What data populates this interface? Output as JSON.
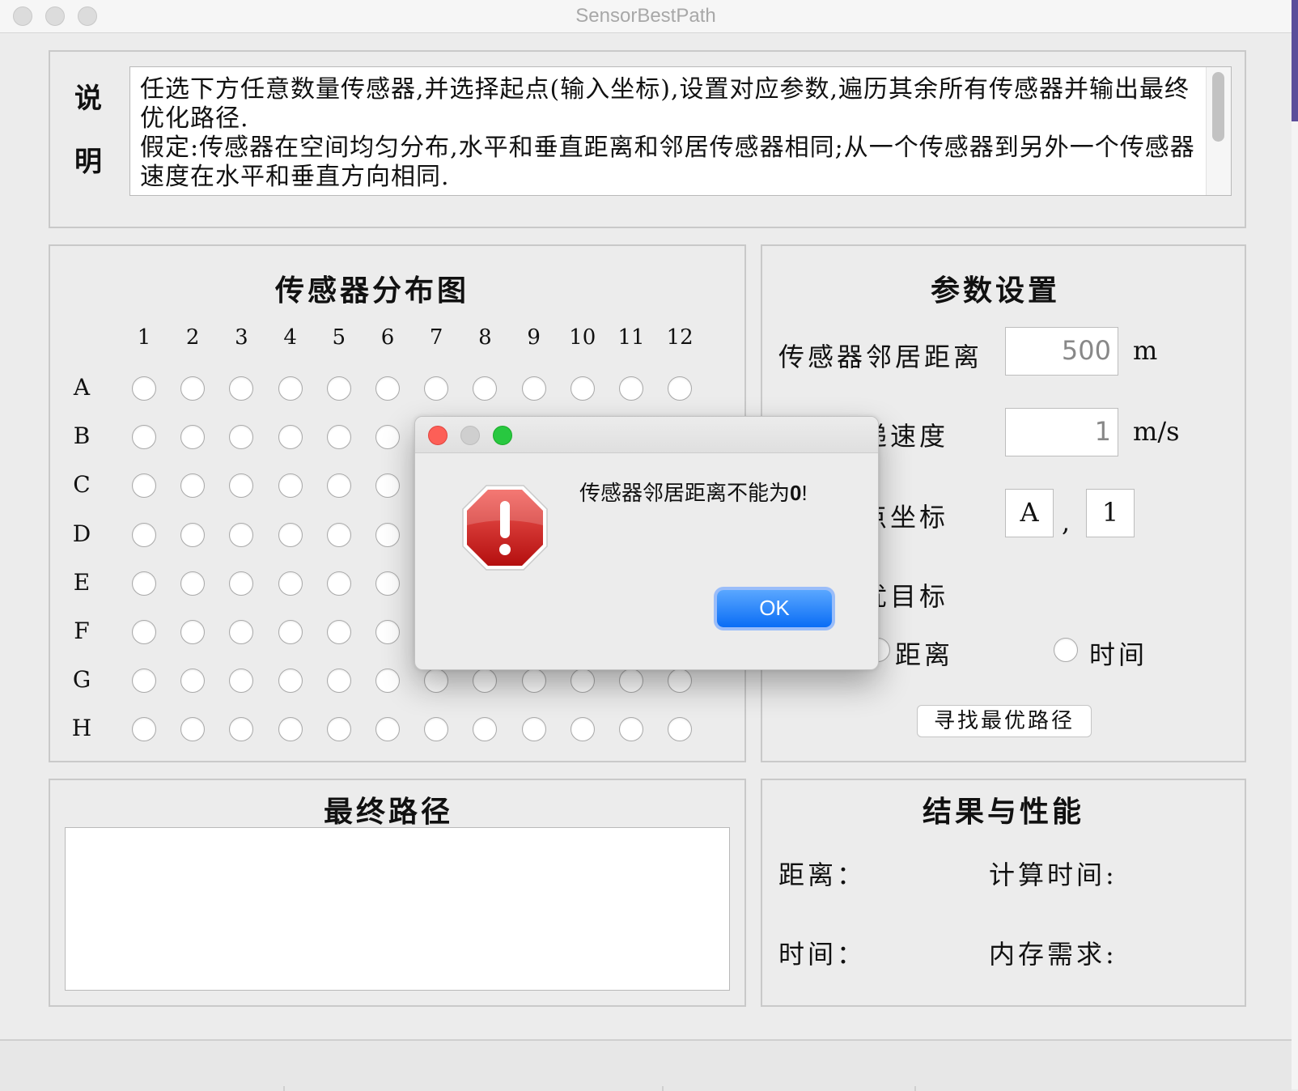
{
  "window": {
    "title": "SensorBestPath"
  },
  "description": {
    "label_line1": "说",
    "label_line2": "明",
    "text_p1": "任选下方任意数量传感器,并选择起点(输入坐标),设置对应参数,遍历其余所有传感器并输出最终优化路径.",
    "text_p2": "假定:传感器在空间均匀分布,水平和垂直距离和邻居传感器相同;从一个传感器到另外一个传感器速度在水平和垂直方向相同."
  },
  "sensor_map": {
    "title": "传感器分布图",
    "columns": [
      "1",
      "2",
      "3",
      "4",
      "5",
      "6",
      "7",
      "8",
      "9",
      "10",
      "11",
      "12"
    ],
    "rows": [
      "A",
      "B",
      "C",
      "D",
      "E",
      "F",
      "G",
      "H"
    ]
  },
  "params": {
    "title": "参数设置",
    "neighbor_distance_label": "传感器邻居距离",
    "neighbor_distance_value": "500",
    "neighbor_distance_unit": "m",
    "speed_label": "传递速度",
    "speed_value": "1",
    "speed_unit": "m/s",
    "start_label": "起点坐标",
    "start_row": "A",
    "start_sep": ",",
    "start_col": "1",
    "target_label": "最优目标",
    "option_distance": "距离",
    "option_time": "时间",
    "find_button": "寻找最优路径"
  },
  "final_path": {
    "title": "最终路径"
  },
  "results": {
    "title": "结果与性能",
    "distance_label": "距离：",
    "calc_time_label": "计算时间:",
    "time_label": "时间：",
    "memory_label": "内存需求:"
  },
  "dialog": {
    "message_prefix": "传感器邻居距离不能为",
    "message_value": "0",
    "message_suffix": "!",
    "ok_label": "OK"
  }
}
